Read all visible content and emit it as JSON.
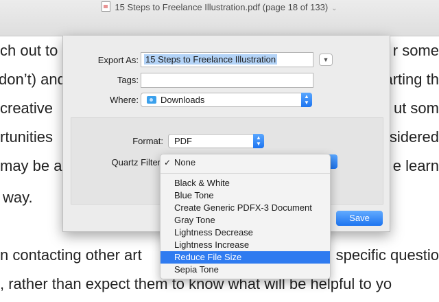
{
  "window": {
    "title": "15 Steps to Freelance Illustration.pdf (page 18 of 133)"
  },
  "document": {
    "lines": [
      {
        "left": "ch out to",
        "right": "r some"
      },
      {
        "left": "don’t) and",
        "right": "arting th"
      },
      {
        "left": "creative",
        "right": "ut som"
      },
      {
        "left": "rtunities",
        "right": "sidered"
      },
      {
        "left": "may be a",
        "right": "e learn"
      },
      {
        "left": "way.",
        "right": ""
      },
      {
        "left": "",
        "right": ""
      },
      {
        "left": "n contacting other art",
        "right": "specific questio"
      },
      {
        "left": ", rather than expect them to know what will be helpful to yo",
        "right": ""
      }
    ]
  },
  "dialog": {
    "export_as_label": "Export As:",
    "export_as_value": "15 Steps to Freelance Illustration",
    "tags_label": "Tags:",
    "tags_value": "",
    "where_label": "Where:",
    "where_value": "Downloads",
    "format_label": "Format:",
    "format_value": "PDF",
    "quartz_label": "Quartz Filter",
    "save_label": "Save"
  },
  "quartz_menu": {
    "selected": "None",
    "items": [
      "Black & White",
      "Blue Tone",
      "Create Generic PDFX-3 Document",
      "Gray Tone",
      "Lightness Decrease",
      "Lightness Increase",
      "Reduce File Size",
      "Sepia Tone"
    ],
    "highlighted": "Reduce File Size"
  },
  "colors": {
    "accent": "#2f7bf0",
    "selection": "#b3d3f7"
  }
}
